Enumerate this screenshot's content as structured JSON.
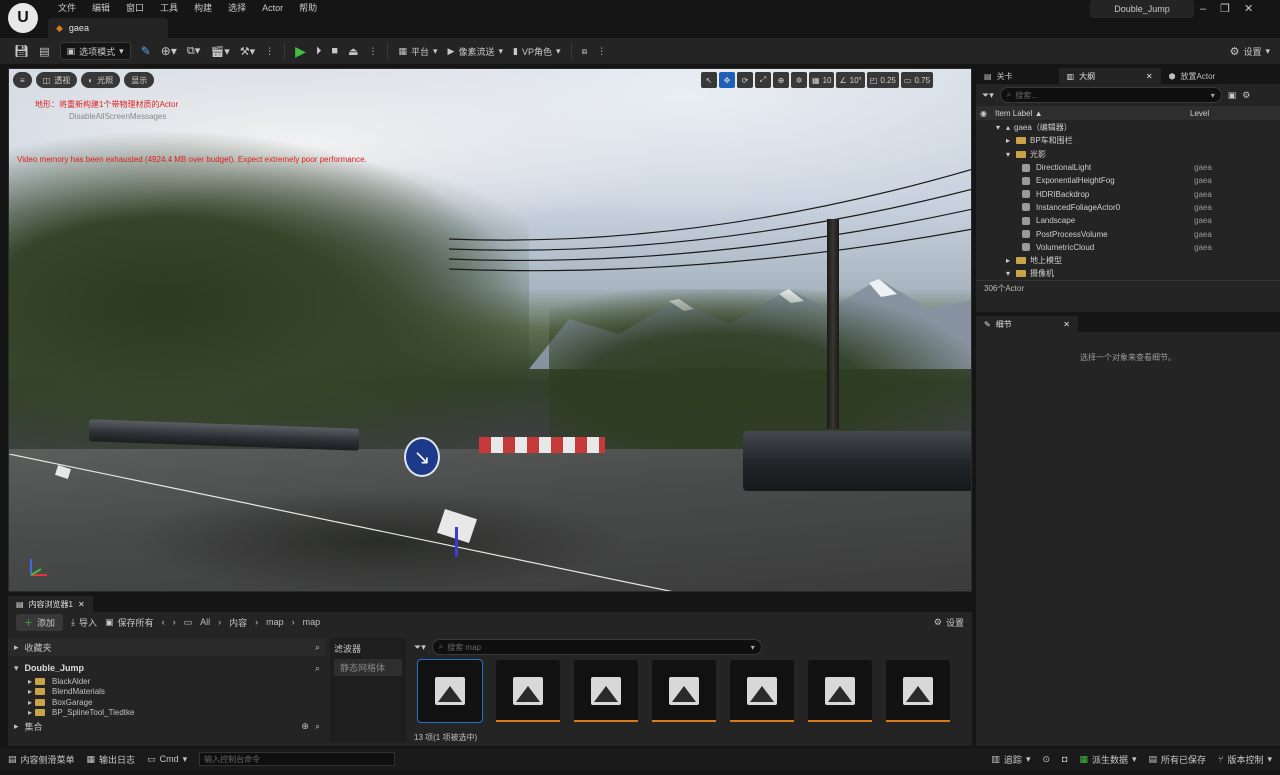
{
  "app": {
    "logo": "U",
    "menu": [
      "文件",
      "编辑",
      "窗口",
      "工具",
      "构建",
      "选择",
      "Actor",
      "帮助"
    ],
    "level_tab": "gaea",
    "project_name": "Double_Jump"
  },
  "toolbar": {
    "mode": "选项模式",
    "platform": "平台",
    "pixel_streaming": "像素流送",
    "vp_role": "VP角色",
    "settings": "设置"
  },
  "viewport": {
    "buttons": [
      "透视",
      "光照",
      "显示"
    ],
    "snap_grid": "10",
    "snap_rotation": "10°",
    "snap_scale": "0.25",
    "camera_speed": "0.75",
    "msg_landscape": "地形：将重新构建1个带物理材质的Actor",
    "msg_disable": "DisableAllScreenMessages",
    "msg_video": "Video memory has been exhausted (4924.4 MB over budget). Expect extremely poor performance."
  },
  "outliner": {
    "tabs": [
      "关卡",
      "大纲",
      "放置Actor"
    ],
    "search_placeholder": "搜索...",
    "col_label": "Item Label ▲",
    "col_level": "Level",
    "rows": [
      {
        "label": "gaea（编辑器）",
        "level": "",
        "type": "root"
      },
      {
        "label": "BP车和围栏",
        "level": "",
        "type": "folder"
      },
      {
        "label": "光影",
        "level": "",
        "type": "folder-open"
      },
      {
        "label": "DirectionalLight",
        "level": "gaea",
        "type": "obj"
      },
      {
        "label": "ExponentialHeightFog",
        "level": "gaea",
        "type": "obj"
      },
      {
        "label": "HDRIBackdrop",
        "level": "gaea",
        "type": "obj"
      },
      {
        "label": "InstancedFoliageActor0",
        "level": "gaea",
        "type": "obj"
      },
      {
        "label": "Landscape",
        "level": "gaea",
        "type": "obj"
      },
      {
        "label": "PostProcessVolume",
        "level": "gaea",
        "type": "obj"
      },
      {
        "label": "VolumetricCloud",
        "level": "gaea",
        "type": "obj"
      },
      {
        "label": "地上模型",
        "level": "",
        "type": "folder"
      },
      {
        "label": "摄像机",
        "level": "",
        "type": "folder-open"
      }
    ],
    "count": "306个Actor"
  },
  "details": {
    "tab": "细节",
    "empty": "选择一个对象来查看细节。"
  },
  "content_browser": {
    "tab": "内容浏览器1",
    "add": "添加",
    "import": "导入",
    "save_all": "保存所有",
    "path": [
      "All",
      "内容",
      "map",
      "map"
    ],
    "settings": "设置",
    "favorites": "收藏夹",
    "project": "Double_Jump",
    "folders": [
      "BlackAlder",
      "BlendMaterials",
      "BoxGarage",
      "BP_SplineTool_Tiedtke"
    ],
    "collections": "集合",
    "filters": "滤波器",
    "filter_item": "静态网格体",
    "search_placeholder": "搜索 map",
    "item_count": "13 项(1 项被选中)",
    "thumb_count": 7
  },
  "statusbar": {
    "drawer": "内容侧滑菜单",
    "output_log": "输出日志",
    "cmd": "Cmd",
    "console_placeholder": "输入控制台命令",
    "trace": "追踪",
    "derived_data": "派生数据",
    "all_saved": "所有已保存",
    "source_control": "版本控制"
  }
}
